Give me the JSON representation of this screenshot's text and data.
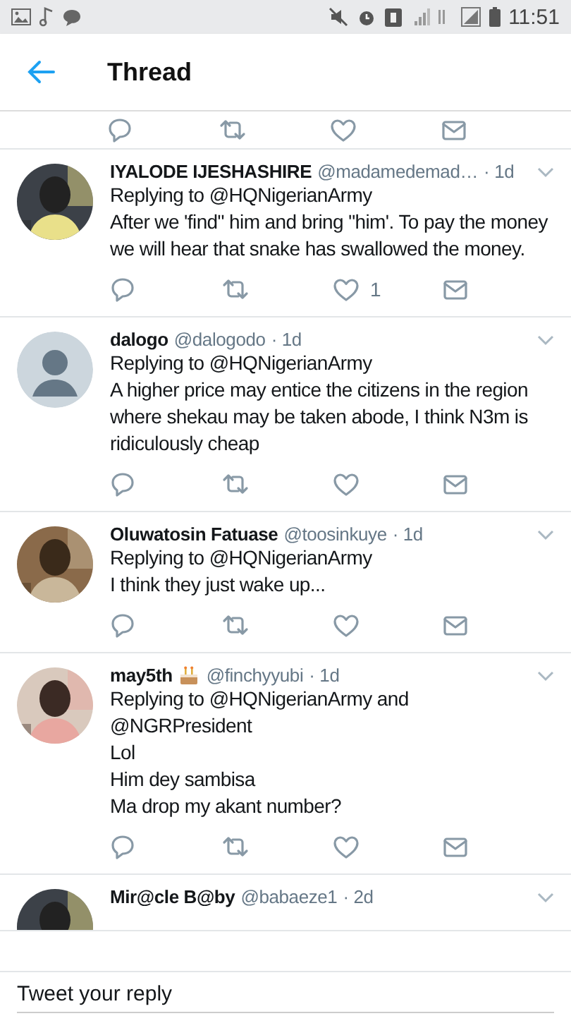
{
  "status_bar": {
    "time": "11:51"
  },
  "header": {
    "title": "Thread"
  },
  "tweets": [
    {
      "kind": "actions_only"
    },
    {
      "name": "IYALODE IJESHASHIRE",
      "handle": "@madamedemad…",
      "time": "· 1d",
      "kind": "tweet",
      "replying": "Replying to @HQNigerianArmy",
      "body": [
        "After we 'find\" him and bring \"him'. To pay the money we will hear that snake has swallowed the money."
      ],
      "likes": "1"
    },
    {
      "name": "dalogo",
      "handle": "@dalogodo",
      "time": "· 1d",
      "kind": "tweet",
      "avatar": {
        "kind": "default"
      },
      "replying": "Replying to @HQNigerianArmy",
      "body": [
        "A higher price may entice the citizens in the region where shekau may be taken abode, I think N3m is ridiculously cheap"
      ]
    },
    {
      "name": "Oluwatosin Fatuase",
      "handle": "@toosinkuye",
      "time": "· 1d",
      "kind": "tweet",
      "replying": "Replying to @HQNigerianArmy",
      "body": [
        "I think they just wake up..."
      ]
    },
    {
      "name": "may5th",
      "cake": true,
      "handle": "@finchyyubi",
      "time": "· 1d",
      "kind": "tweet",
      "replying": "Replying to @HQNigerianArmy and @NGRPresident",
      "body": [
        "Lol",
        "Him dey sambisa",
        "Ma drop my akant number?"
      ]
    },
    {
      "kind": "cut_off",
      "name": "Mir@cle B@by",
      "handle": "@babaeze1",
      "time": "· 2d"
    }
  ],
  "reply_bar": {
    "placeholder": "Tweet your reply"
  }
}
